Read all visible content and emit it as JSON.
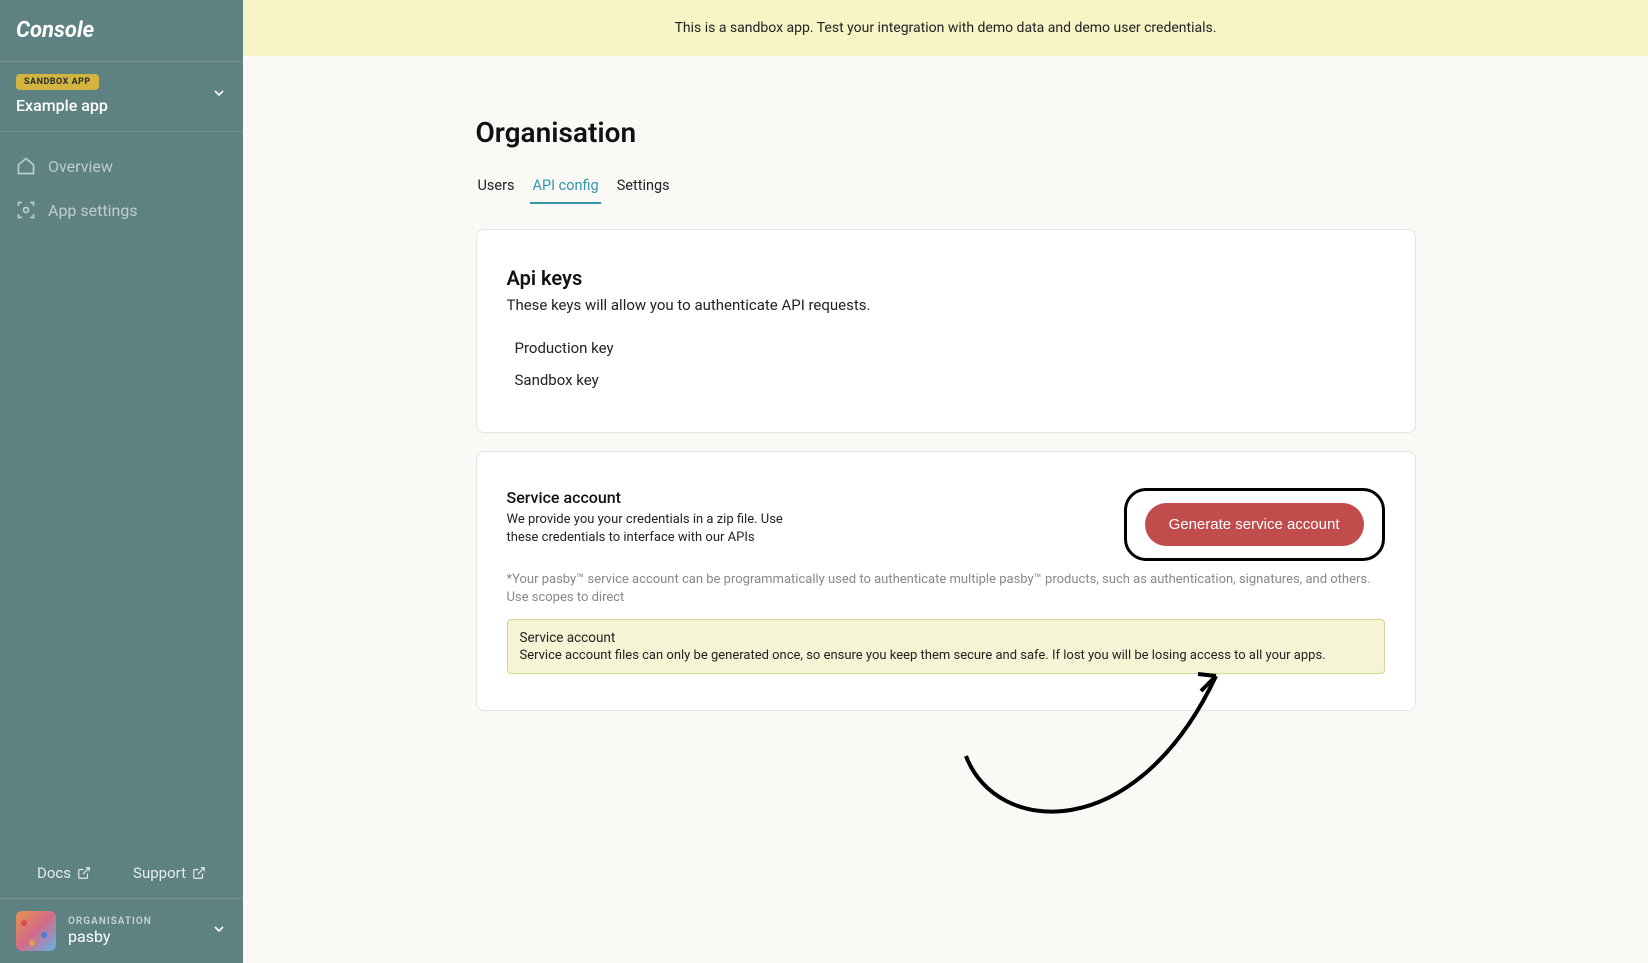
{
  "sidebar": {
    "logo": "Console",
    "sandbox_badge": "SANDBOX APP",
    "app_name": "Example app",
    "nav": {
      "overview": "Overview",
      "app_settings": "App settings"
    },
    "links": {
      "docs": "Docs",
      "support": "Support"
    },
    "org": {
      "label": "ORGANISATION",
      "name": "pasby"
    }
  },
  "banner": "This is a sandbox app. Test your integration with demo data and demo user credentials.",
  "page": {
    "title": "Organisation",
    "tabs": {
      "users": "Users",
      "api_config": "API config",
      "settings": "Settings"
    }
  },
  "api_keys": {
    "title": "Api keys",
    "subtitle": "These keys will allow you to authenticate API requests.",
    "keys": [
      "Production key",
      "Sandbox key"
    ]
  },
  "service_account": {
    "title": "Service account",
    "desc": "We provide you your credentials in a zip file. Use these credentials to interface with our APIs",
    "button": "Generate service account",
    "note": "*Your pasby™ service account can be programmatically used to authenticate multiple pasby™ products, such as authentication, signatures, and others. Use scopes to direct",
    "warning_title": "Service account",
    "warning_text": "Service account files can only be generated once, so ensure you keep them secure and safe. If lost you will be losing access to all your apps."
  }
}
